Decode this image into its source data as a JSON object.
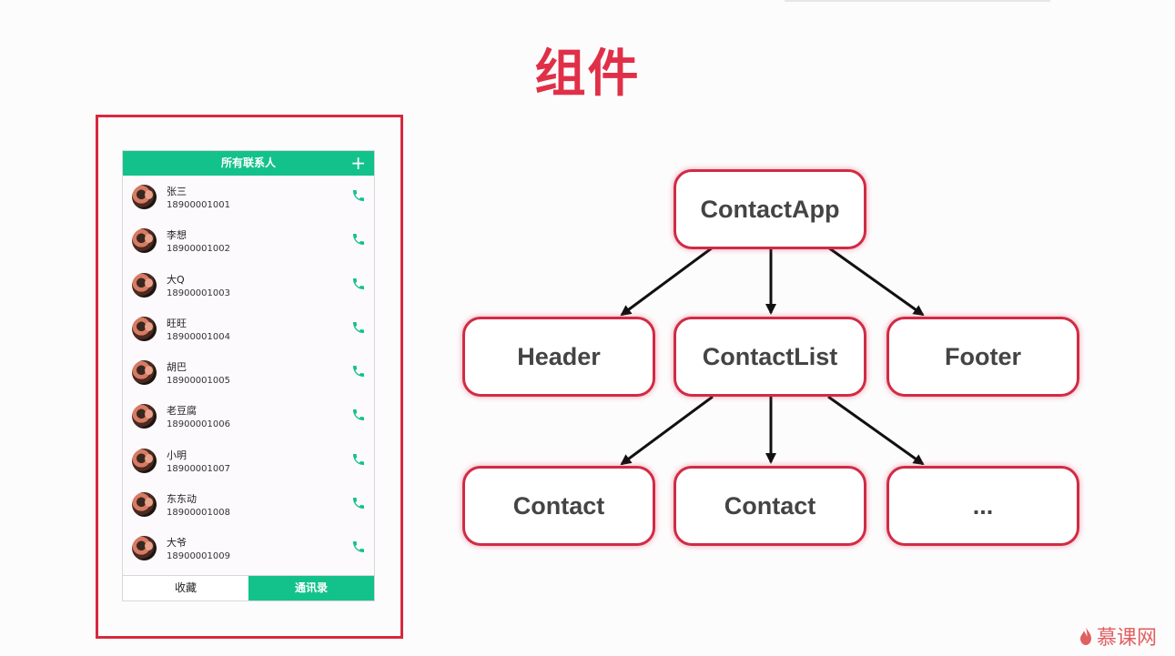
{
  "title": "组件",
  "phone": {
    "header_title": "所有联系人",
    "add_label": "+",
    "contacts": [
      {
        "name": "张三",
        "phone": "18900001001"
      },
      {
        "name": "李想",
        "phone": "18900001002"
      },
      {
        "name": "大Q",
        "phone": "18900001003"
      },
      {
        "name": "旺旺",
        "phone": "18900001004"
      },
      {
        "name": "胡巴",
        "phone": "18900001005"
      },
      {
        "name": "老豆腐",
        "phone": "18900001006"
      },
      {
        "name": "小明",
        "phone": "18900001007"
      },
      {
        "name": "东东动",
        "phone": "18900001008"
      },
      {
        "name": "大爷",
        "phone": "18900001009"
      }
    ],
    "tabs": {
      "favorites": "收藏",
      "contacts": "通讯录"
    }
  },
  "tree": {
    "root": "ContactApp",
    "level2": [
      "Header",
      "ContactList",
      "Footer"
    ],
    "level3": [
      "Contact",
      "Contact",
      "..."
    ]
  },
  "watermark": "慕课网",
  "colors": {
    "accent_red": "#d12b45",
    "phone_green": "#12c28a"
  },
  "icons": {
    "call": "phone-icon",
    "add": "plus-icon",
    "brand": "flame-icon"
  }
}
